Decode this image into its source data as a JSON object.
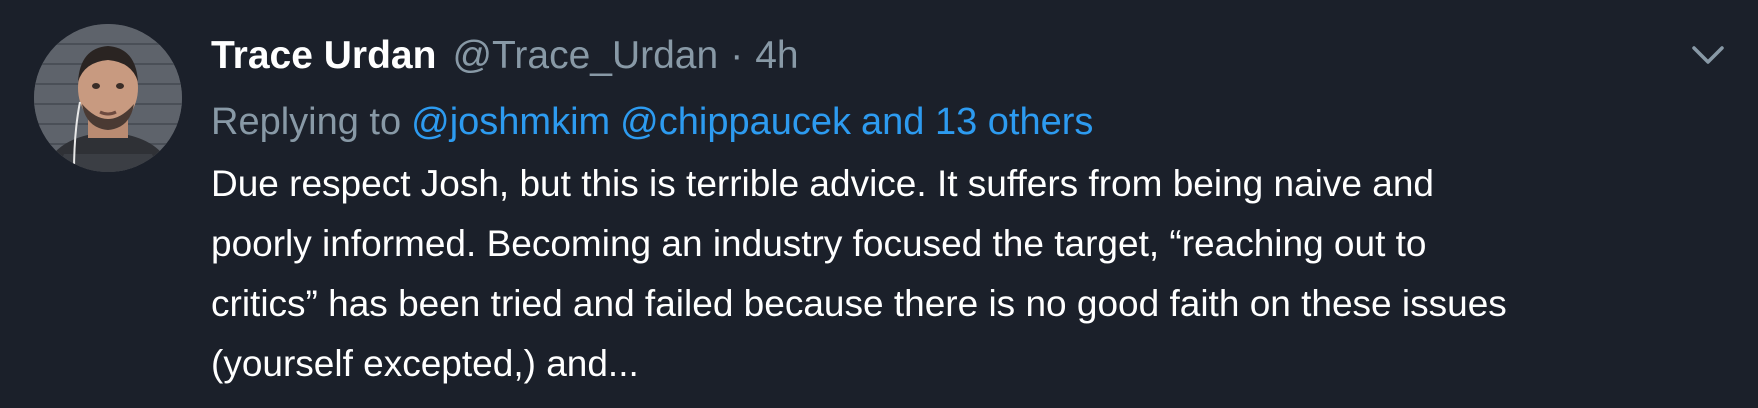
{
  "tweet": {
    "display_name": "Trace Urdan",
    "handle": "@Trace_Urdan",
    "separator": "·",
    "time": "4h",
    "reply_prefix": "Replying to",
    "mention_1": "@joshmkim",
    "mention_2": "@chippaucek",
    "others": "and 13 others",
    "body_lines": [
      "Due respect Josh, but this is terrible advice. It suffers from being naive and",
      "poorly informed. Becoming an industry focused the target, “reaching out to",
      "critics” has been tried and failed because there is no good faith on these issues",
      "(yourself excepted,) and..."
    ]
  },
  "icons": {
    "menu": "chevron-down-icon",
    "avatar": "avatar"
  },
  "colors": {
    "background": "#1b202a",
    "text": "#ffffff",
    "muted": "#8899a6",
    "accent": "#2d9bf0"
  }
}
